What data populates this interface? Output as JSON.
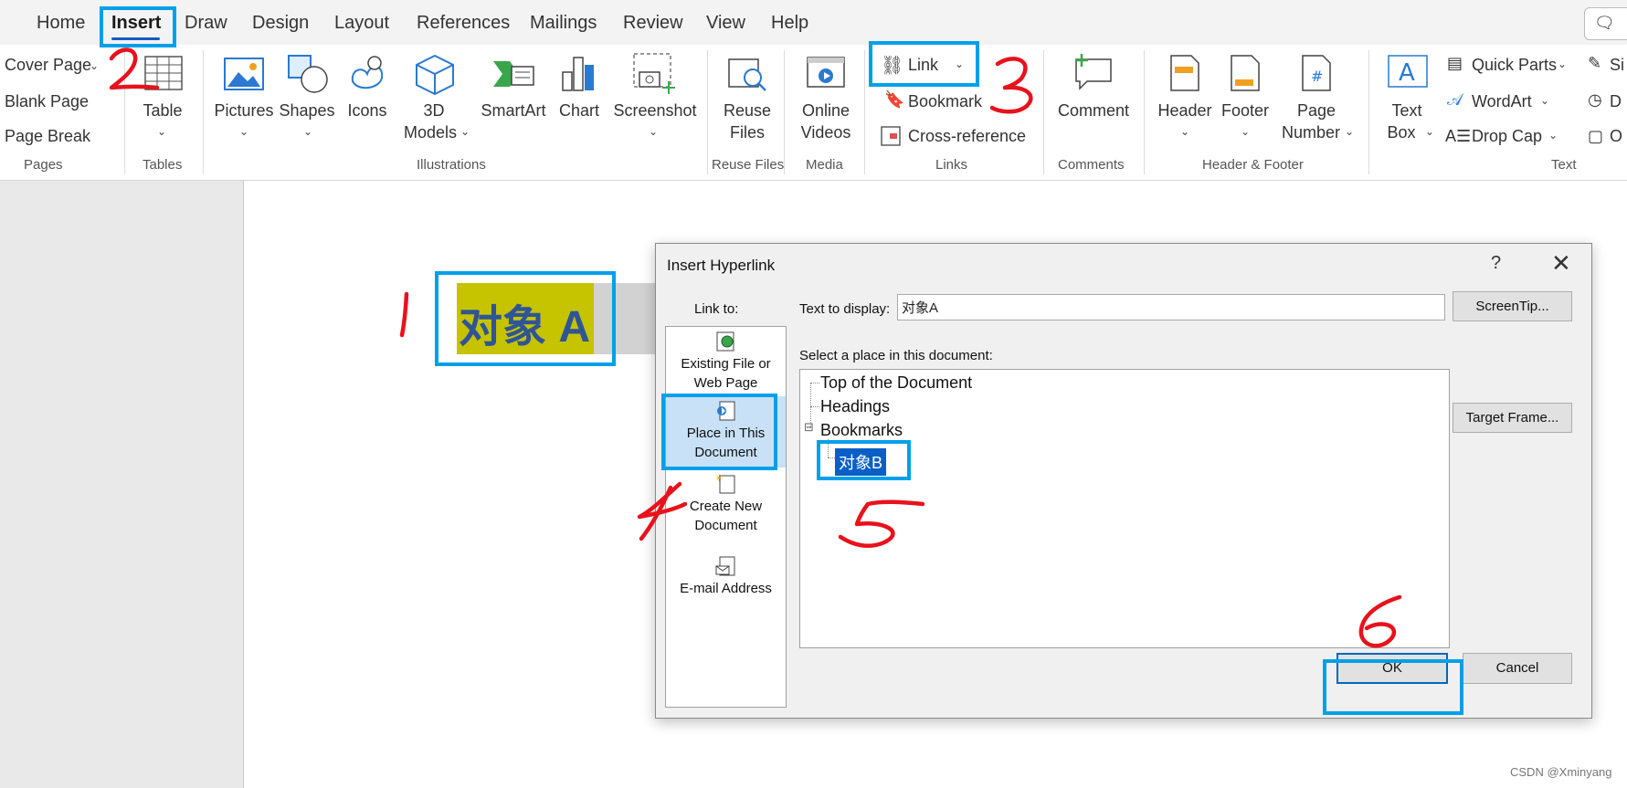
{
  "menu": {
    "tabs": [
      "Home",
      "Insert",
      "Draw",
      "Design",
      "Layout",
      "References",
      "Mailings",
      "Review",
      "View",
      "Help"
    ],
    "active_tab": "Insert"
  },
  "ribbon": {
    "pages": {
      "cover_page": "Cover Page",
      "blank_page": "Blank Page",
      "page_break": "Page Break",
      "group": "Pages"
    },
    "tables": {
      "table": "Table",
      "group": "Tables"
    },
    "illustrations": {
      "pictures": "Pictures",
      "shapes": "Shapes",
      "icons": "Icons",
      "models_line1": "3D",
      "models_line2": "Models",
      "smartart": "SmartArt",
      "chart": "Chart",
      "screenshot": "Screenshot",
      "group": "Illustrations"
    },
    "reuse": {
      "line1": "Reuse",
      "line2": "Files",
      "group": "Reuse Files"
    },
    "media": {
      "line1": "Online",
      "line2": "Videos",
      "group": "Media"
    },
    "links": {
      "link": "Link",
      "bookmark": "Bookmark",
      "cross_reference": "Cross-reference",
      "group": "Links"
    },
    "comments": {
      "comment": "Comment",
      "group": "Comments"
    },
    "header_footer": {
      "header": "Header",
      "footer": "Footer",
      "page_line1": "Page",
      "page_line2": "Number",
      "group": "Header & Footer"
    },
    "text": {
      "textbox_line1": "Text",
      "textbox_line2": "Box",
      "quick_parts": "Quick Parts",
      "wordart": "WordArt",
      "drop_cap": "Drop Cap",
      "group": "Text",
      "cut1": "Si",
      "cut2": "D",
      "cut3": "O"
    }
  },
  "document": {
    "object_a": "对象 A"
  },
  "dialog": {
    "title": "Insert Hyperlink",
    "help": "?",
    "close": "✕",
    "link_to_label": "Link to:",
    "link_to_items": [
      {
        "line1": "Existing File or",
        "line2": "Web Page"
      },
      {
        "line1": "Place in This",
        "line2": "Document"
      },
      {
        "line1": "Create New",
        "line2": "Document"
      },
      {
        "line1": "E-mail Address",
        "line2": ""
      }
    ],
    "text_to_display_label": "Text to display:",
    "text_to_display_value": "对象A",
    "screentip_button": "ScreenTip...",
    "place_label": "Select a place in this document:",
    "tree": {
      "top": "Top of the Document",
      "headings": "Headings",
      "bookmarks": "Bookmarks",
      "bookmark_item": "对象B",
      "expander": "⊟"
    },
    "target_frame_button": "Target Frame...",
    "ok_button": "OK",
    "cancel_button": "Cancel"
  },
  "annotations": {
    "highlight_color": "#00a0e9",
    "mark_color": "#e8121c"
  },
  "watermark": "CSDN @Xminyang"
}
